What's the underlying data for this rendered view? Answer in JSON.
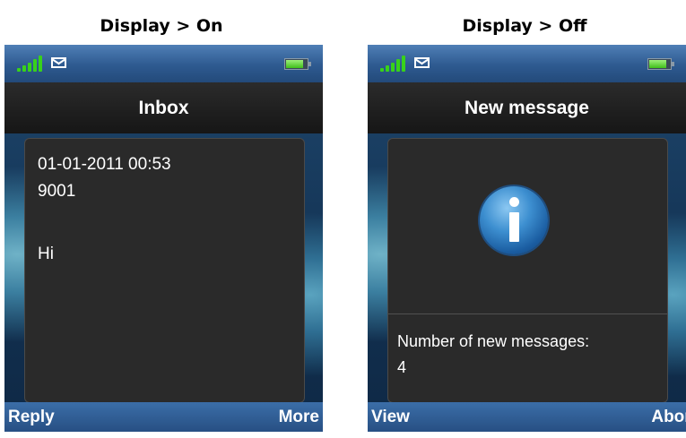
{
  "captions": {
    "left": "Display > On",
    "right": "Display > Off"
  },
  "colors": {
    "status_bar": "#2e5a90",
    "title_bar": "#1f1f1f",
    "softkey_bar": "#3b6ea8",
    "signal": "#38d21a",
    "panel": "#2a2a2a",
    "info_icon": "#3d8fd0"
  },
  "icons": {
    "signal": "signal-strength-icon",
    "message": "envelope-icon",
    "battery": "battery-icon",
    "info": "info-icon"
  },
  "left_screen": {
    "title": "Inbox",
    "message": {
      "date": "01-01-2011 00:53",
      "sender": "9001",
      "body": "Hi"
    },
    "softkeys": {
      "left": "Reply",
      "right": "More"
    }
  },
  "right_screen": {
    "title": "New message",
    "info_label": "Number of new messages:",
    "info_value": "4",
    "softkeys": {
      "left": "View",
      "right": "Abort"
    }
  }
}
